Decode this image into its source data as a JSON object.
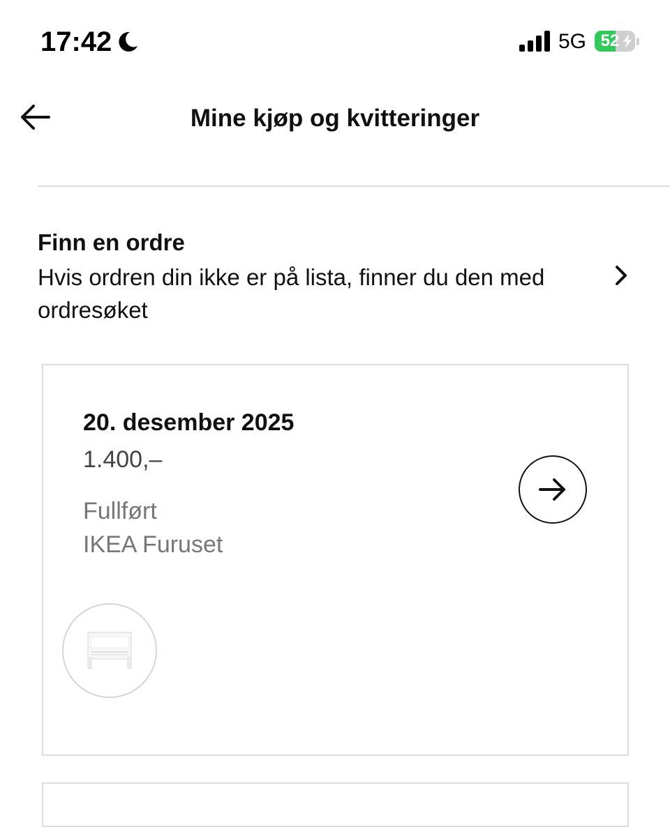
{
  "status_bar": {
    "time": "17:42",
    "network": "5G",
    "battery_level": "52",
    "battery_fraction": 0.52,
    "icons": [
      "moon-icon",
      "signal-icon",
      "battery-icon",
      "bolt-icon"
    ]
  },
  "header": {
    "title": "Mine kjøp og kvitteringer",
    "back_icon": "arrow-left-icon"
  },
  "find_order": {
    "title": "Finn en ordre",
    "description": "Hvis ordren din ikke er på lista, finner du den med ordresøket",
    "icon": "chevron-right-icon"
  },
  "orders": [
    {
      "date": "20. desember 2025",
      "amount": "1.400,–",
      "status": "Fullført",
      "store": "IKEA Furuset",
      "action_icon": "arrow-right-icon",
      "thumbnail_icon": "headboard-product-image"
    }
  ],
  "colors": {
    "text_primary": "#111111",
    "text_secondary": "#767676",
    "border": "#dcdcdc",
    "battery_green": "#34c759"
  }
}
